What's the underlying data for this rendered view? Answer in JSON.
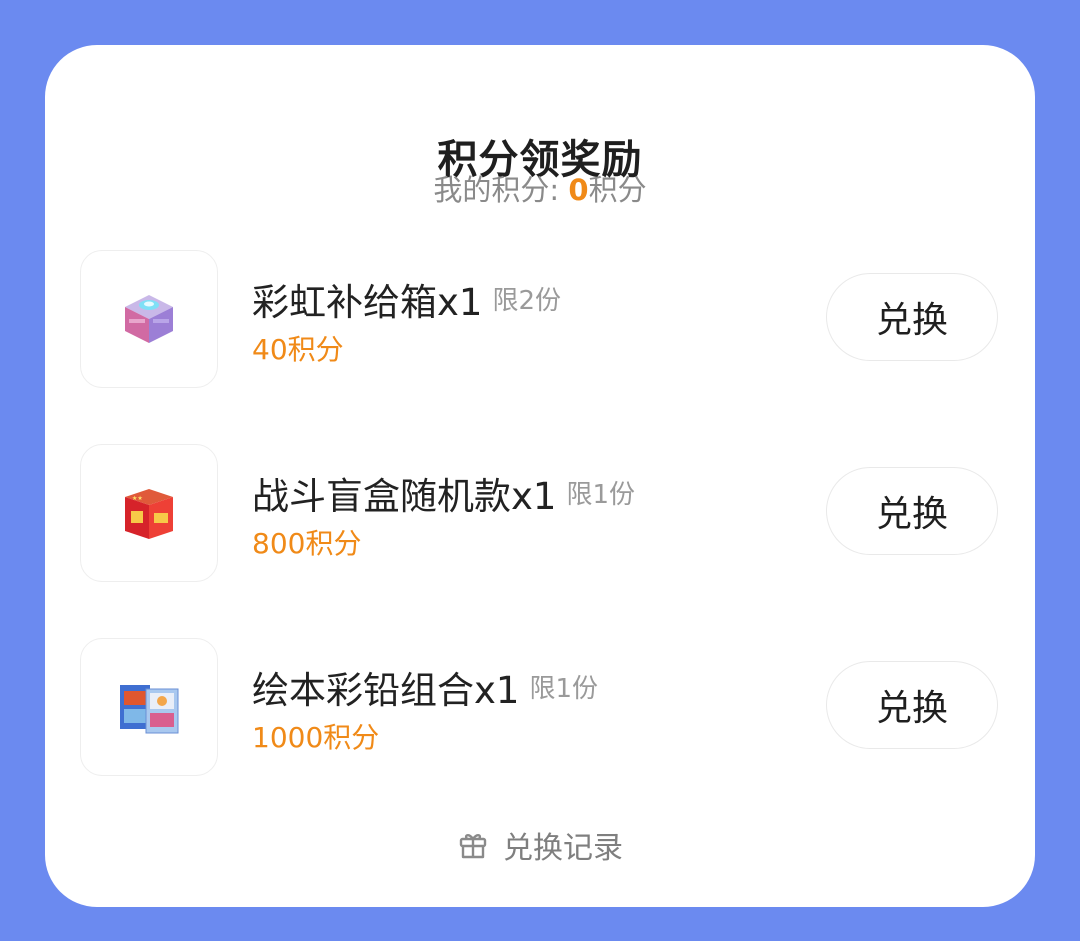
{
  "header": {
    "title": "积分领奖励",
    "points_label": "我的积分: ",
    "points_value": "0",
    "points_unit": "积分"
  },
  "rewards": [
    {
      "name": "彩虹补给箱x1",
      "limit": "限2份",
      "cost": "40积分",
      "button": "兑换",
      "icon": "supply-box-image"
    },
    {
      "name": "战斗盲盒随机款x1",
      "limit": "限1份",
      "cost": "800积分",
      "button": "兑换",
      "icon": "blind-box-image"
    },
    {
      "name": "绘本彩铅组合x1",
      "limit": "限1份",
      "cost": "1000积分",
      "button": "兑换",
      "icon": "picture-book-pencil-set-image"
    }
  ],
  "footer": {
    "history_label": "兑换记录",
    "history_icon": "gift-icon"
  },
  "colors": {
    "background": "#6b8af0",
    "accent": "#f08a18",
    "card": "#ffffff"
  }
}
